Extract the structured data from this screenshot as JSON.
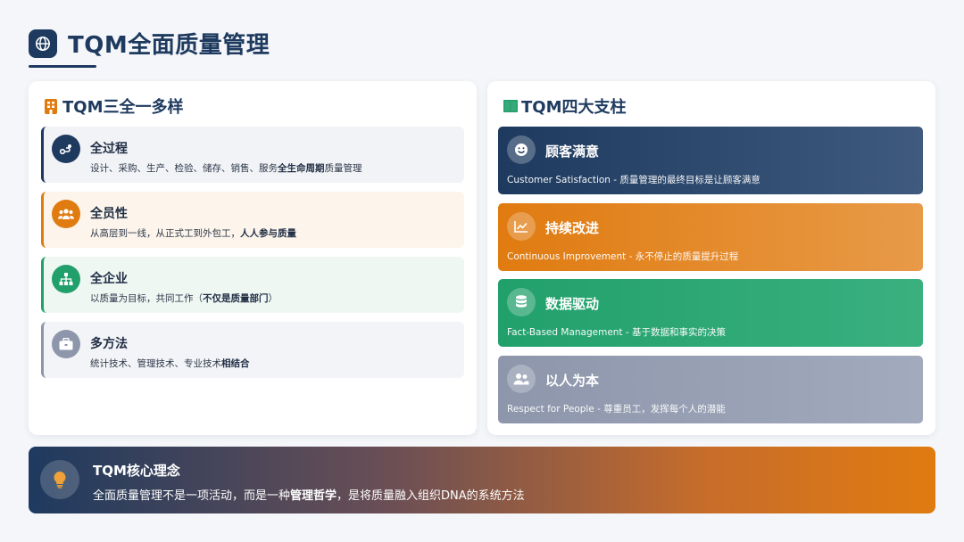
{
  "header": {
    "title": "TQM全面质量管理",
    "icon": "globe-icon"
  },
  "left_panel": {
    "title": "TQM三全一多样",
    "icon": "building-icon",
    "items": [
      {
        "title": "全过程",
        "desc_prefix": "设计、采购、生产、检验、储存、销售、服务",
        "desc_bold": "全生命周期",
        "desc_suffix": "质量管理",
        "icon": "route-icon",
        "accent": "#1e3a5f"
      },
      {
        "title": "全员性",
        "desc_prefix": "从高层到一线，从正式工到外包工，",
        "desc_bold": "人人参与质量",
        "desc_suffix": "",
        "icon": "users-icon",
        "accent": "#e07b10"
      },
      {
        "title": "全企业",
        "desc_prefix": "以质量为目标，共同工作（",
        "desc_bold": "不仅是质量部门",
        "desc_suffix": "）",
        "icon": "sitemap-icon",
        "accent": "#22a06b"
      },
      {
        "title": "多方法",
        "desc_prefix": "统计技术、管理技术、专业技术",
        "desc_bold": "相结合",
        "desc_suffix": "",
        "icon": "toolbox-icon",
        "accent": "#8d96ab"
      }
    ]
  },
  "right_panel": {
    "title": "TQM四大支柱",
    "icon": "columns-icon",
    "pillars": [
      {
        "title": "顾客满意",
        "desc": "Customer Satisfaction - 质量管理的最终目标是让顾客满意",
        "icon": "smile-icon"
      },
      {
        "title": "持续改进",
        "desc": "Continuous Improvement - 永不停止的质量提升过程",
        "icon": "chart-line-icon"
      },
      {
        "title": "数据驱动",
        "desc": "Fact-Based Management - 基于数据和事实的决策",
        "icon": "database-icon"
      },
      {
        "title": "以人为本",
        "desc": "Respect for People - 尊重员工，发挥每个人的潜能",
        "icon": "people-icon"
      }
    ]
  },
  "banner": {
    "title": "TQM核心理念",
    "desc_prefix": "全面质量管理不是一项活动，而是一种",
    "desc_bold": "管理哲学",
    "desc_suffix": "，是将质量融入组织DNA的系统方法",
    "icon": "lightbulb-icon"
  },
  "colors": {
    "navy": "#1e3a5f",
    "orange": "#e07b10",
    "green": "#22a06b",
    "gray": "#8d96ab"
  }
}
